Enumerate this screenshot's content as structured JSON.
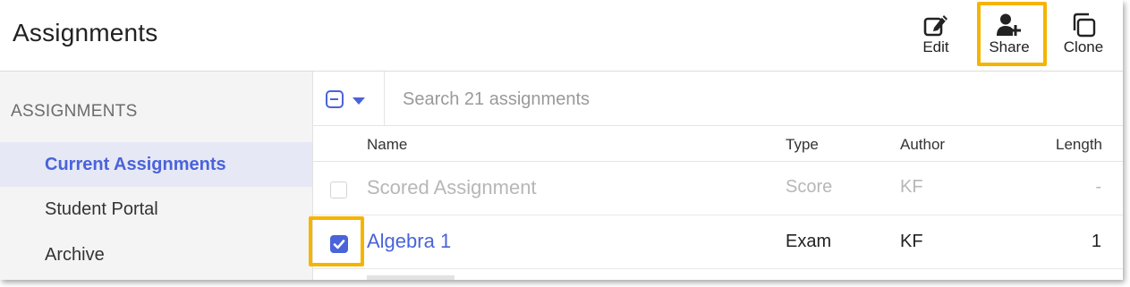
{
  "header": {
    "title": "Assignments",
    "actions": [
      {
        "label": "Edit",
        "icon": "edit-icon"
      },
      {
        "label": "Share",
        "icon": "user-plus-icon",
        "highlighted": true
      },
      {
        "label": "Clone",
        "icon": "clone-icon"
      }
    ]
  },
  "sidebar": {
    "heading": "ASSIGNMENTS",
    "items": [
      {
        "label": "Current Assignments",
        "active": true
      },
      {
        "label": "Student Portal",
        "active": false
      },
      {
        "label": "Archive",
        "active": false
      }
    ]
  },
  "toolbar": {
    "bulk_select_icon": "checkbox-indeterminate-icon",
    "search_placeholder": "Search 21 assignments"
  },
  "table": {
    "columns": [
      "Name",
      "Type",
      "Author",
      "Length"
    ],
    "rows": [
      {
        "name": "Scored Assignment",
        "type": "Score",
        "author": "KF",
        "length": "-",
        "checked": false,
        "disabled": true
      },
      {
        "name": "Algebra 1",
        "type": "Exam",
        "author": "KF",
        "length": "1",
        "checked": true,
        "disabled": false
      }
    ]
  },
  "colors": {
    "accent": "#4a63d9",
    "highlight": "#f5b400",
    "sidebar_active_bg": "#e6e8f5",
    "sidebar_bg": "#f4f4f4"
  }
}
